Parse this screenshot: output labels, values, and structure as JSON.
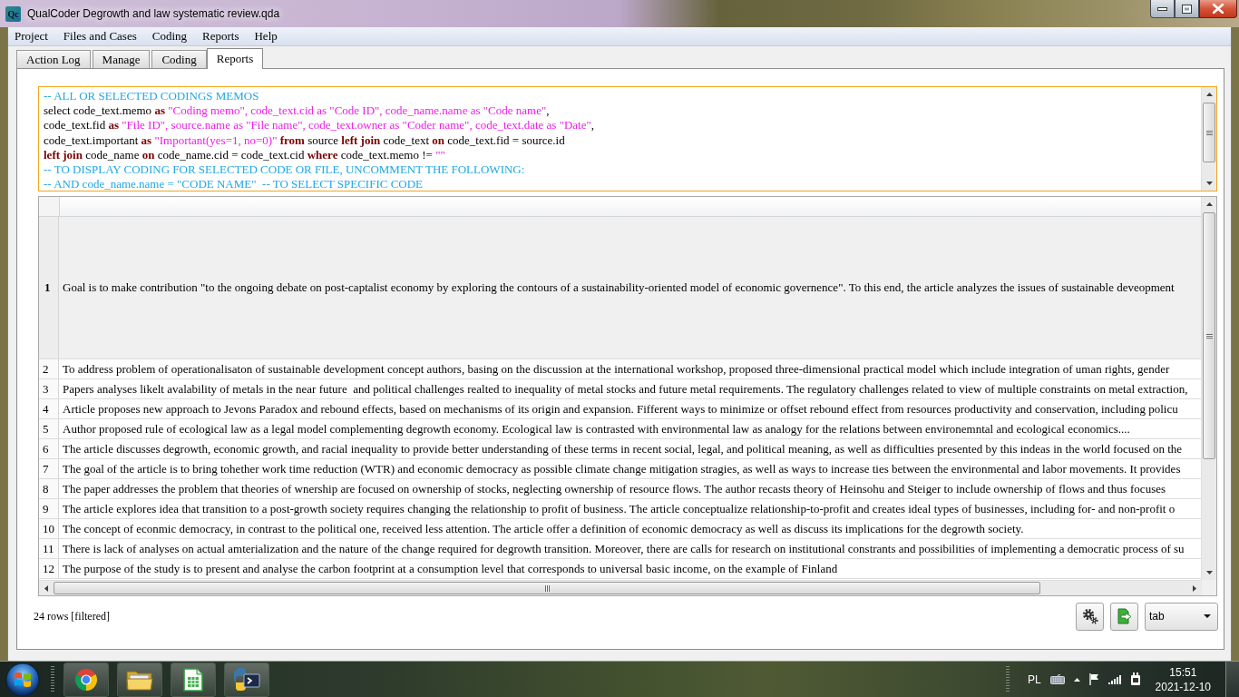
{
  "window": {
    "logo": "Qc",
    "title": "QualCoder Degrowth and law systematic review.qda"
  },
  "menu": [
    "Project",
    "Files and Cases",
    "Coding",
    "Reports",
    "Help"
  ],
  "tabs": [
    {
      "label": "Action Log",
      "selected": false
    },
    {
      "label": "Manage",
      "selected": false
    },
    {
      "label": "Coding",
      "selected": false
    },
    {
      "label": "Reports",
      "selected": true
    }
  ],
  "sql_editor": {
    "lines": [
      [
        {
          "kind": "comment",
          "text": "-- ALL OR SELECTED CODINGS MEMOS"
        }
      ],
      [
        {
          "kind": "plain",
          "text": "select code_text.memo "
        },
        {
          "kind": "keyword",
          "text": "as "
        },
        {
          "kind": "string",
          "text": "\"Coding memo\", code_text.cid as \"Code ID\", code_name.name as \"Code name\""
        },
        {
          "kind": "plain",
          "text": ","
        }
      ],
      [
        {
          "kind": "plain",
          "text": "code_text.fid "
        },
        {
          "kind": "keyword",
          "text": "as "
        },
        {
          "kind": "string",
          "text": "\"File ID\", source.name as \"File name\", code_text.owner as \"Coder name\", code_text.date as \"Date\""
        },
        {
          "kind": "plain",
          "text": ","
        }
      ],
      [
        {
          "kind": "plain",
          "text": "code_text.important "
        },
        {
          "kind": "keyword",
          "text": "as "
        },
        {
          "kind": "string",
          "text": "\"Important(yes=1, no=0)\""
        },
        {
          "kind": "keyword",
          "text": " from"
        },
        {
          "kind": "plain",
          "text": " source "
        },
        {
          "kind": "keyword",
          "text": "left join"
        },
        {
          "kind": "plain",
          "text": " code_text "
        },
        {
          "kind": "keyword",
          "text": "on"
        },
        {
          "kind": "plain",
          "text": " code_text.fid = source.id"
        }
      ],
      [
        {
          "kind": "keyword",
          "text": "left join"
        },
        {
          "kind": "plain",
          "text": " code_name "
        },
        {
          "kind": "keyword",
          "text": "on"
        },
        {
          "kind": "plain",
          "text": " code_name.cid = code_text.cid "
        },
        {
          "kind": "keyword",
          "text": "where"
        },
        {
          "kind": "plain",
          "text": " code_text.memo != "
        },
        {
          "kind": "string",
          "text": "\"\""
        }
      ],
      [
        {
          "kind": "comment",
          "text": "-- TO DISPLAY CODING FOR SELECTED CODE OR FILE, UNCOMMENT THE FOLLOWING:"
        }
      ],
      [
        {
          "kind": "comment",
          "text": "-- AND code_name.name = \"CODE NAME\"  -- TO SELECT SPECIFIC CODE"
        }
      ]
    ]
  },
  "results_table": {
    "rows": [
      {
        "number": "1",
        "text": "Goal is to make contribution \"to the ongoing debate on post-captalist economy by exploring the contours of a sustainability-oriented model of economic governence\". To this end, the article analyzes the issues of sustainable deveopment",
        "selected": true
      },
      {
        "number": "2",
        "text": "To address problem of operationalisaton of sustainable development concept authors, basing on the discussion at the international workshop, proposed three-dimensional practical model which include integration of uman rights, gender",
        "selected": false
      },
      {
        "number": "3",
        "text": "Papers analyses likelt avalability of metals in the near future  and political challenges realted to inequality of metal stocks and future metal requirements. The regulatory challenges related to view of multiple constraints on metal extraction,",
        "selected": false
      },
      {
        "number": "4",
        "text": "Article proposes new approach to Jevons Paradox and rebound effects, based on mechanisms of its origin and expansion. Fifferent ways to minimize or offset rebound effect from resources productivity and conservation, including policu",
        "selected": false
      },
      {
        "number": "5",
        "text": "Author proposed rule of ecological law as a legal model complementing degrowth economy. Ecological law is contrasted with environmental law as analogy for the relations between environemntal and ecological economics....",
        "selected": false
      },
      {
        "number": "6",
        "text": "The article discusses degrowth, economic growth, and racial inequality to provide better understanding of these terms in recent social, legal, and political meaning, as well as difficulties presented by this indeas in the world focused on the",
        "selected": false
      },
      {
        "number": "7",
        "text": "The goal of the article is to bring tohether work time reduction (WTR) and economic democracy as possible climate change mitigation stragies, as well as ways to increase ties between the environmental and labor movements. It provides",
        "selected": false
      },
      {
        "number": "8",
        "text": "The paper addresses the problem that theories of wnership are focused on ownership of stocks, neglecting ownership of resource flows. The author recasts theory of Heinsohu and Steiger to include ownership of flows and thus focuses",
        "selected": false
      },
      {
        "number": "9",
        "text": "The article explores idea that transition to a post-growth society requires changing the relationship to profit of business. The article conceptualize relationship-to-profit and creates ideal types of businesses, including for- and non-profit o",
        "selected": false
      },
      {
        "number": "10",
        "text": "The concept of econmic democracy, in contrast to the political one, received less attention. The article offer a definition of economic democracy as well as discuss its implications for the degrowth society.",
        "selected": false
      },
      {
        "number": "11",
        "text": "There is lack of analyses on actual amterialization and the nature of the change required for degrowth transition. Moreover, there are calls for research on institutional constrants and possibilities of implementing a democratic process of su",
        "selected": false
      },
      {
        "number": "12",
        "text": "The purpose of the study is to present and analyse the carbon footprint at a consumption level that corresponds to universal basic income, on the example of Finland",
        "selected": false
      }
    ]
  },
  "footer": {
    "row_count": "24 rows [filtered]",
    "export_format": "tab"
  },
  "taskbar": {
    "language": "PL",
    "time": "15:51",
    "date": "2021-12-10"
  }
}
